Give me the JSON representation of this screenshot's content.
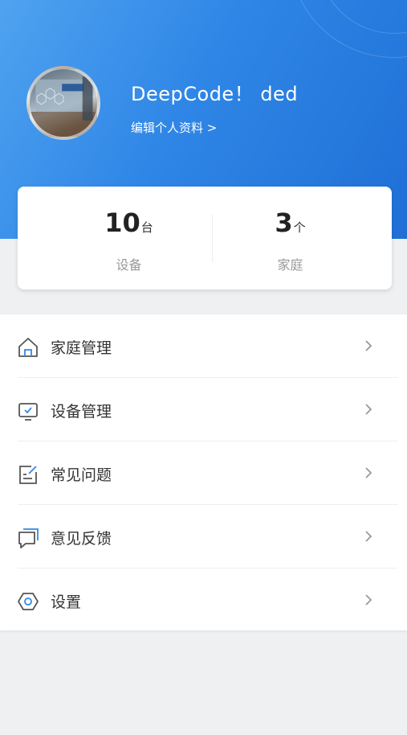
{
  "profile": {
    "username": "DeepCode！ ded",
    "edit_profile_label": "编辑个人资料 >"
  },
  "stats": [
    {
      "value": "10",
      "unit": "台",
      "label": "设备"
    },
    {
      "value": "3",
      "unit": "个",
      "label": "家庭"
    }
  ],
  "menu": [
    {
      "label": "家庭管理",
      "icon": "home-icon"
    },
    {
      "label": "设备管理",
      "icon": "monitor-icon"
    },
    {
      "label": "常见问题",
      "icon": "edit-note-icon"
    },
    {
      "label": "意见反馈",
      "icon": "chat-bubble-icon"
    },
    {
      "label": "设置",
      "icon": "hexagon-settings-icon"
    }
  ],
  "colors": {
    "header_start": "#4fa3f0",
    "header_end": "#1f6fd6",
    "icon_accent": "#2f8ae8",
    "background": "#eff0f2"
  }
}
